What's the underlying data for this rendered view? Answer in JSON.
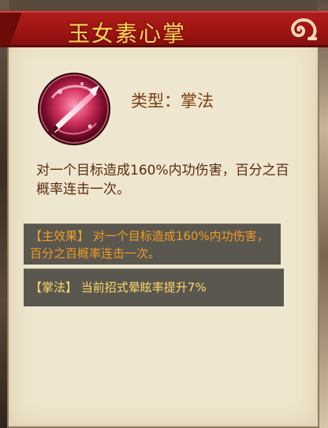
{
  "skill": {
    "name": "玉女素心掌",
    "type_line": "类型：掌法",
    "description": "对一个目标造成160%内功伤害，百分之百概率连击一次。",
    "icon": "pink-sword-orb-icon"
  },
  "effects": {
    "main_tag": "【主效果】",
    "main_text": "对一个目标造成160%内功伤害，百分之百概率连击一次。",
    "style_tag": "【掌法】",
    "style_text": "当前招式晕眩率提升7%"
  },
  "colors": {
    "title_bg": "#a3171a",
    "title_text": "#ffd25a",
    "panel_bg": "#efe6cf",
    "effect_text": "#f19b22",
    "style_text": "#ffd76a",
    "box_bg": "#5a574f"
  }
}
